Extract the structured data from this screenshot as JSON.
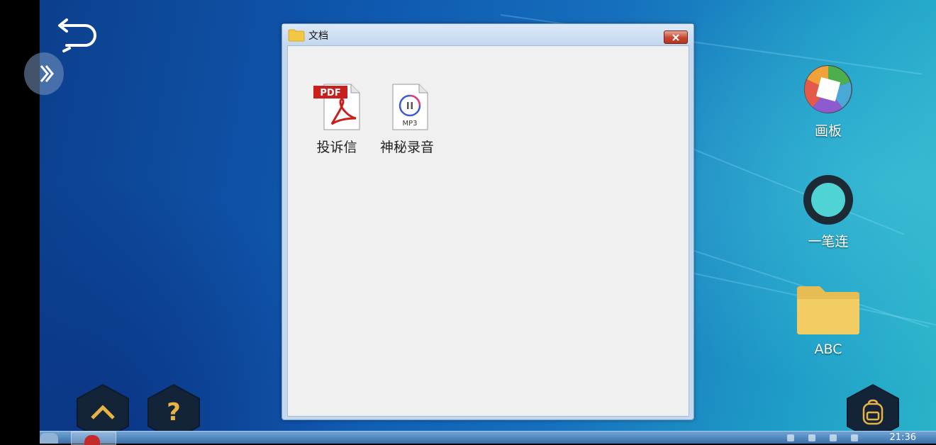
{
  "window": {
    "title": "文档",
    "close_label": "x",
    "files": [
      {
        "name": "投诉信",
        "type": "PDF"
      },
      {
        "name": "神秘录音",
        "type": "MP3"
      }
    ]
  },
  "desktop_icons": [
    {
      "label": "画板",
      "icon": "palette-app-icon"
    },
    {
      "label": "一笔连",
      "icon": "one-stroke-app-icon"
    },
    {
      "label": "ABC",
      "icon": "folder-icon"
    }
  ],
  "overlay_controls": {
    "back": "back-arrow-icon",
    "expand": "double-chevron-right-icon",
    "up": "chevron-up-icon",
    "help_label": "?",
    "inventory": "backpack-icon"
  },
  "taskbar": {
    "clock": "21:36"
  },
  "colors": {
    "accent_gold": "#e7b444",
    "window_frame": "#c5d9ee",
    "close_red": "#c9452f"
  }
}
